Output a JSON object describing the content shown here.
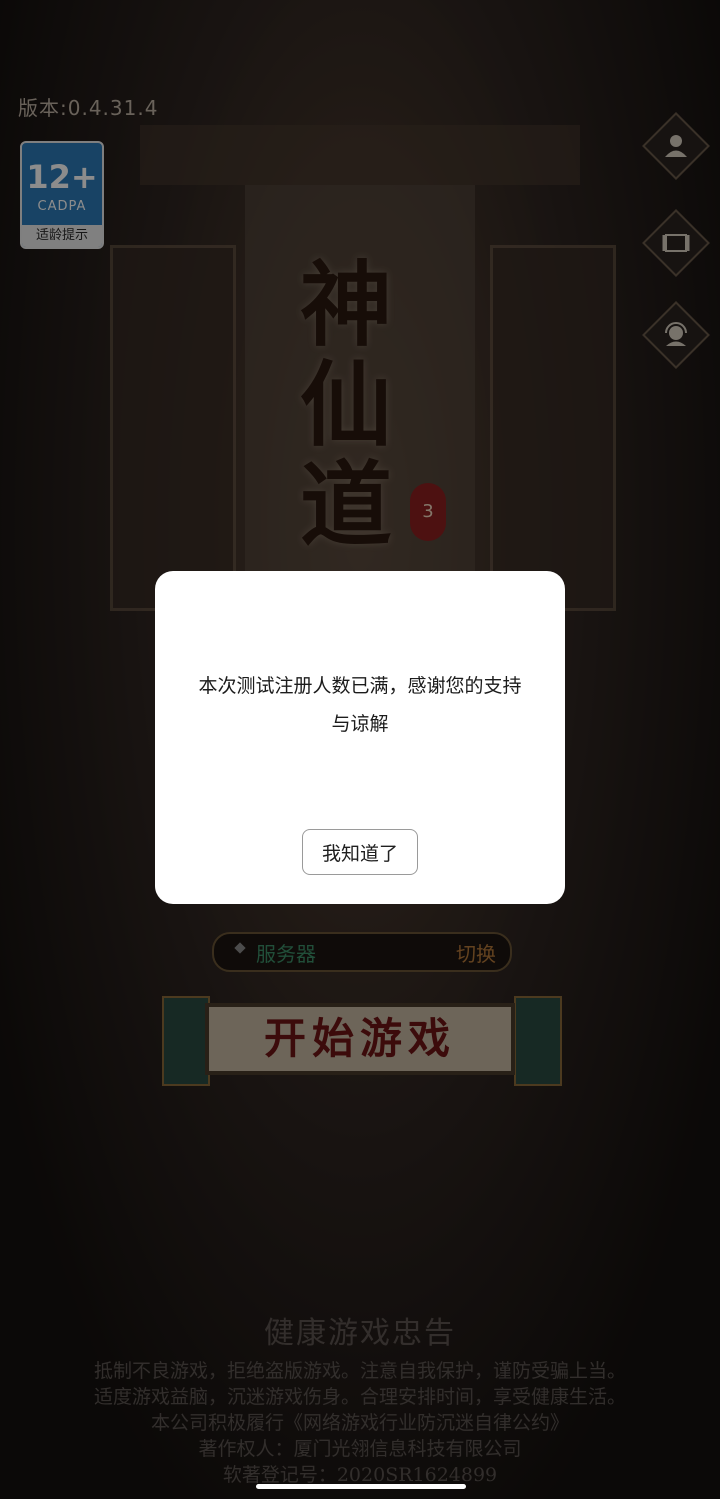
{
  "header": {
    "version_label": "版本:0.4.31.4"
  },
  "age_badge": {
    "rating": "12+",
    "org": "CADPA",
    "tip": "适龄提示"
  },
  "side_buttons": [
    {
      "icon": "user-icon"
    },
    {
      "icon": "scroll-icon"
    },
    {
      "icon": "customer-service-icon"
    }
  ],
  "logo": {
    "chars": [
      "神",
      "仙",
      "道"
    ],
    "seal": "3"
  },
  "server": {
    "label": "服务器",
    "switch_label": "切换"
  },
  "start_button": {
    "label": "开始游戏"
  },
  "advice": {
    "title": "健康游戏忠告",
    "lines": [
      "抵制不良游戏，拒绝盗版游戏。注意自我保护，谨防受骗上当。",
      "适度游戏益脑，沉迷游戏伤身。合理安排时间，享受健康生活。",
      "本公司积极履行《网络游戏行业防沉迷自律公约》",
      "著作权人：厦门光翎信息科技有限公司",
      "软著登记号：2020SR1624899"
    ]
  },
  "dialog": {
    "message_line1": "本次测试注册人数已满，感谢您的支持",
    "message_line2": "与谅解",
    "confirm_label": "我知道了"
  }
}
